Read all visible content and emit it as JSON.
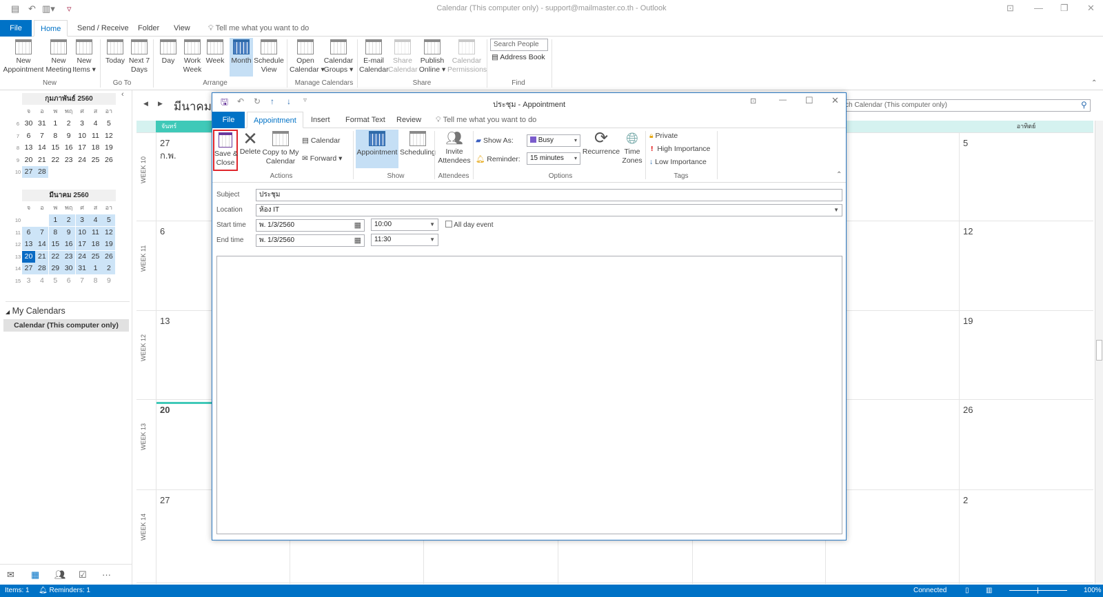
{
  "app": {
    "title": "Calendar (This computer only) - support@mailmaster.co.th  -  Outlook",
    "tabs": [
      "File",
      "Home",
      "Send / Receive",
      "Folder",
      "View"
    ],
    "active_tab": "Home",
    "tell_me": "Tell me what you want to do"
  },
  "ribbon": {
    "buttons": [
      {
        "label": "New\nAppointment",
        "icon": "new-appointment-icon"
      },
      {
        "label": "New\nMeeting",
        "icon": "new-meeting-icon"
      },
      {
        "label": "New\nItems ▾",
        "icon": "new-items-icon"
      },
      {
        "label": "Today",
        "icon": "today-icon"
      },
      {
        "label": "Next 7\nDays",
        "icon": "next-7-days-icon"
      },
      {
        "label": "Day",
        "icon": "day-view-icon"
      },
      {
        "label": "Work\nWeek",
        "icon": "work-week-icon"
      },
      {
        "label": "Week",
        "icon": "week-view-icon"
      },
      {
        "label": "Month",
        "icon": "month-view-icon",
        "selected": true
      },
      {
        "label": "Schedule\nView",
        "icon": "schedule-view-icon"
      },
      {
        "label": "Open\nCalendar ▾",
        "icon": "open-calendar-icon"
      },
      {
        "label": "Calendar\nGroups ▾",
        "icon": "calendar-groups-icon"
      },
      {
        "label": "E-mail\nCalendar",
        "icon": "email-calendar-icon"
      },
      {
        "label": "Share\nCalendar",
        "icon": "share-calendar-icon",
        "disabled": true
      },
      {
        "label": "Publish\nOnline ▾",
        "icon": "publish-online-icon"
      },
      {
        "label": "Calendar\nPermissions",
        "icon": "calendar-permissions-icon",
        "disabled": true
      }
    ],
    "groups": [
      "New",
      "Go To",
      "Arrange",
      "Manage Calendars",
      "Share",
      "Find"
    ],
    "search_people_placeholder": "Search People",
    "address_book": "Address Book"
  },
  "mini_calendars": [
    {
      "title": "กุมภาพันธ์ 2560",
      "dow": [
        "จ",
        "อ",
        "พ",
        "พฤ",
        "ศ",
        "ส",
        "อา"
      ],
      "weeks": [
        6,
        7,
        8,
        9,
        10
      ],
      "days": [
        [
          "30",
          "31",
          "1",
          "2",
          "3",
          "4",
          "5"
        ],
        [
          "6",
          "7",
          "8",
          "9",
          "10",
          "11",
          "12"
        ],
        [
          "13",
          "14",
          "15",
          "16",
          "17",
          "18",
          "19"
        ],
        [
          "20",
          "21",
          "22",
          "23",
          "24",
          "25",
          "26"
        ],
        [
          "27",
          "28",
          "",
          "",
          "",
          "",
          ""
        ]
      ]
    },
    {
      "title": "มีนาคม 2560",
      "dow": [
        "จ",
        "อ",
        "พ",
        "พฤ",
        "ศ",
        "ส",
        "อา"
      ],
      "weeks": [
        10,
        11,
        12,
        13,
        14,
        15
      ],
      "days": [
        [
          "",
          "",
          "1",
          "2",
          "3",
          "4",
          "5"
        ],
        [
          "6",
          "7",
          "8",
          "9",
          "10",
          "11",
          "12"
        ],
        [
          "13",
          "14",
          "15",
          "16",
          "17",
          "18",
          "19"
        ],
        [
          "20",
          "21",
          "22",
          "23",
          "24",
          "25",
          "26"
        ],
        [
          "27",
          "28",
          "29",
          "30",
          "31",
          "1",
          "2"
        ],
        [
          "3",
          "4",
          "5",
          "6",
          "7",
          "8",
          "9"
        ]
      ]
    }
  ],
  "today": "20",
  "my_calendars": {
    "heading": "My Calendars",
    "items": [
      "Calendar (This computer only)"
    ]
  },
  "calendar": {
    "month_title": "มีนาคม",
    "search_placeholder": "Search Calendar (This computer only)",
    "headers": {
      "monday": "จันทร์",
      "sunday": "อาทิตย์"
    },
    "week_labels": [
      "WEEK 10",
      "WEEK 11",
      "WEEK 12",
      "WEEK 13",
      "WEEK 14"
    ],
    "monday_dates": [
      "27 ก.พ.",
      "6",
      "13",
      "20",
      "27"
    ],
    "saturday_dates": [
      "",
      "",
      "",
      "",
      "1 เม.ย."
    ],
    "sunday_dates": [
      "5",
      "12",
      "19",
      "26",
      "2"
    ]
  },
  "status": {
    "items": "Items: 1",
    "reminders": "Reminders: 1",
    "connection": "Connected",
    "zoom": "100%"
  },
  "dialog": {
    "title": "ประชุม  -  Appointment",
    "tabs": [
      "File",
      "Appointment",
      "Insert",
      "Format Text",
      "Review"
    ],
    "tell_me": "Tell me what you want to do",
    "actions": {
      "save_close": "Save &\nClose",
      "delete": "Delete",
      "copy": "Copy to My\nCalendar",
      "calendar": "Calendar",
      "forward": "Forward"
    },
    "show": {
      "appointment": "Appointment",
      "scheduling": "Scheduling"
    },
    "invite": "Invite\nAttendees",
    "options": {
      "show_as_label": "Show As:",
      "show_as": "Busy",
      "reminder_label": "Reminder:",
      "reminder": "15 minutes",
      "recurrence": "Recurrence",
      "time_zones": "Time\nZones"
    },
    "tags": {
      "private": "Private",
      "high": "High Importance",
      "low": "Low Importance"
    },
    "group_labels": [
      "Actions",
      "Show",
      "Attendees",
      "Options",
      "Tags"
    ],
    "form": {
      "subject_label": "Subject",
      "subject": "ประชุม",
      "location_label": "Location",
      "location": "ห้อง IT",
      "start_label": "Start time",
      "start_date": "พ. 1/3/2560",
      "start_time": "10:00",
      "all_day": "All day event",
      "end_label": "End time",
      "end_date": "พ. 1/3/2560",
      "end_time": "11:30"
    },
    "colors": {
      "busy": "#7b5ccc",
      "highlight_box": "#e0252b"
    }
  }
}
